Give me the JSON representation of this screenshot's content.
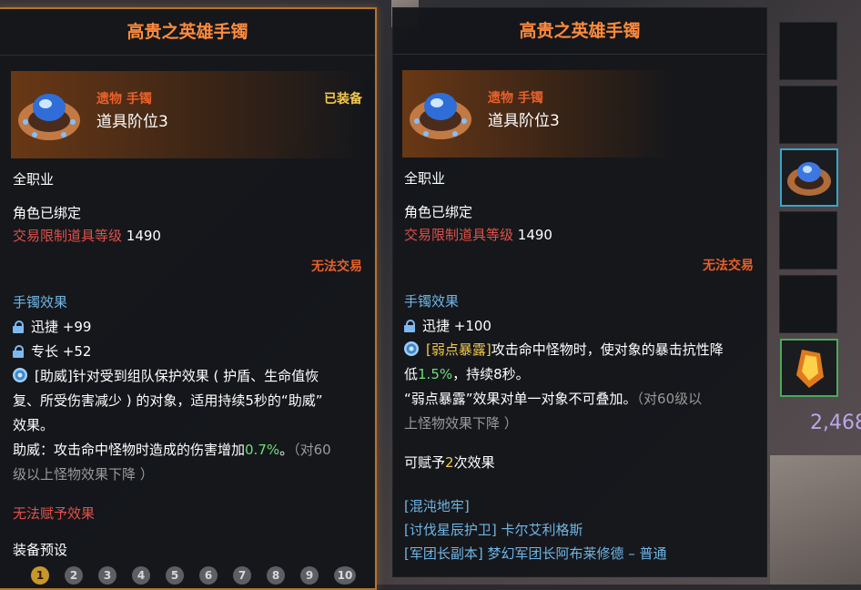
{
  "left_tooltip": {
    "title": "高贵之英雄手镯",
    "category": "遗物 手镯",
    "tier": "道具阶位3",
    "equipped": "已装备",
    "class_req": "全职业",
    "bound": "角色已绑定",
    "trade_level_label": "交易限制道具等级",
    "trade_level_value": "1490",
    "untradeable": "无法交易",
    "effect_header": "手镯效果",
    "stat1": "迅捷 +99",
    "stat2": "专长 +52",
    "special_1": "[助威]针对受到组队保护效果 ( 护盾、生命值恢",
    "special_2": "复、所受伤害减少 ) 的对象，适用持续5秒的“助威”",
    "special_3": "效果。",
    "special_4a": "助威：攻击命中怪物时造成的伤害增加",
    "special_4b": "0.7%",
    "special_4c": "。",
    "special_4d": "（对60",
    "special_5": "级以上怪物效果下降 ）",
    "no_enchant": "无法赋予效果",
    "preset_header": "装备预设",
    "presets": [
      "1",
      "2",
      "3",
      "4",
      "5",
      "6",
      "7",
      "8",
      "9",
      "10"
    ]
  },
  "right_tooltip": {
    "title": "高贵之英雄手镯",
    "category": "遗物 手镯",
    "tier": "道具阶位3",
    "class_req": "全职业",
    "bound": "角色已绑定",
    "trade_level_label": "交易限制道具等级",
    "trade_level_value": "1490",
    "untradeable": "无法交易",
    "effect_header": "手镯效果",
    "stat1": "迅捷 +100",
    "special_1a": "[弱点暴露]",
    "special_1b": "攻击命中怪物时，使对象的暴击抗性降",
    "special_2a": "低",
    "special_2b": "1.5%",
    "special_2c": "，持续8秒。",
    "special_3a": "“弱点暴露”效果对单一对象不可叠加。",
    "special_3b": "（对60级以",
    "special_4": "上怪物效果下降 ）",
    "enchant_a": "可赋予",
    "enchant_b": "2",
    "enchant_c": "次效果",
    "source1": "[混沌地牢]",
    "source2": "[讨伐星辰护卫] 卡尔艾利格斯",
    "source3": "[军团长副本] 梦幻军团长阿布莱修德 – 普通"
  },
  "background": {
    "price": "2,468"
  }
}
